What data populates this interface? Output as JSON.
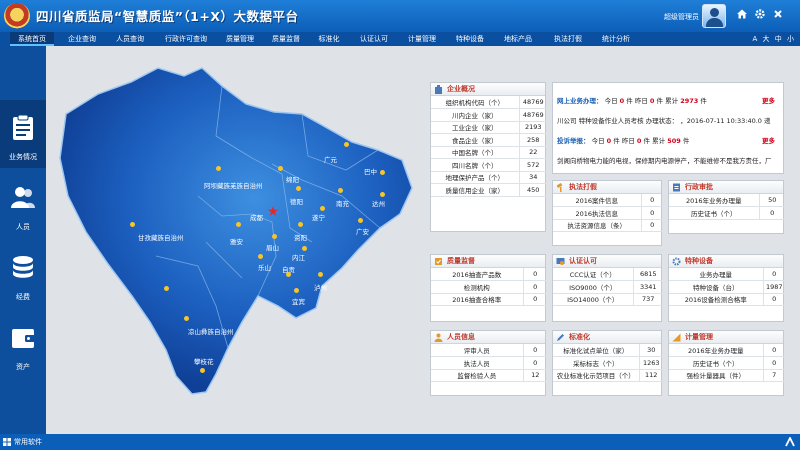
{
  "header": {
    "title": "四川省质监局“智慧质监”（1+X）大数据平台",
    "user_name": "超级管理员"
  },
  "nav": {
    "tabs": [
      "系统首页",
      "企业查询",
      "人员查询",
      "行政许可查询",
      "质量管理",
      "质量监督",
      "标准化",
      "认证认可",
      "计量管理",
      "特种设备",
      "地标产品",
      "执法打假",
      "统计分析"
    ],
    "font_size": {
      "label": "A",
      "large": "大",
      "medium": "中",
      "small": "小"
    }
  },
  "sidebar": {
    "items": [
      {
        "label": "业务情况"
      },
      {
        "label": "人员"
      },
      {
        "label": "经费"
      },
      {
        "label": "资产"
      }
    ]
  },
  "map": {
    "cities": [
      "广元",
      "巴中",
      "绵阳",
      "阿坝藏族羌族自治州",
      "德阳",
      "南充",
      "达州",
      "成都",
      "遂宁",
      "广安",
      "甘孜藏族自治州",
      "雅安",
      "眉山",
      "资阳",
      "乐山",
      "内江",
      "自贡",
      "宜宾",
      "泸州",
      "凉山彝族自治州",
      "攀枝花"
    ]
  },
  "panels": {
    "enterprise": {
      "title": "企业概况",
      "rows": [
        [
          "组织机构代码（个）",
          "48769"
        ],
        [
          "川内企业（家）",
          "48769"
        ],
        [
          "工业企业（家）",
          "2193"
        ],
        [
          "食品企业（家）",
          "258"
        ],
        [
          "中国名牌（个）",
          "22"
        ],
        [
          "四川名牌（个）",
          "572"
        ],
        [
          "地理保护产品（个）",
          "34"
        ],
        [
          "质量信用企业（家）",
          "450"
        ]
      ]
    },
    "enforcement": {
      "title": "执法打假",
      "rows": [
        [
          "2016案件信息",
          "0"
        ],
        [
          "2016执法信息",
          "0"
        ],
        [
          "执法资源信息（条）",
          "0"
        ]
      ]
    },
    "admin": {
      "title": "行政审批",
      "rows": [
        [
          "2016年业务办理量",
          "50"
        ],
        [
          "历史证书（个）",
          "0"
        ]
      ]
    },
    "quality": {
      "title": "质量监督",
      "rows": [
        [
          "2016抽查产品数",
          "0"
        ],
        [
          "检测机构",
          "0"
        ],
        [
          "2016抽查合格率",
          "0"
        ]
      ]
    },
    "certification": {
      "title": "认证认可",
      "rows": [
        [
          "CCC认证（个）",
          "6815"
        ],
        [
          "ISO9000（个）",
          "3341"
        ],
        [
          "ISO14000（个）",
          "737"
        ]
      ]
    },
    "special": {
      "title": "特种设备",
      "rows": [
        [
          "业务办理量",
          "0"
        ],
        [
          "特种设备（台）",
          "1987"
        ],
        [
          "2016设备检测合格率",
          "0"
        ]
      ]
    },
    "personnel": {
      "title": "人员信息",
      "rows": [
        [
          "评审人员",
          "0"
        ],
        [
          "执法人员",
          "0"
        ],
        [
          "监督检验人员",
          "12"
        ]
      ]
    },
    "standard": {
      "title": "标准化",
      "rows": [
        [
          "标准化试点单位（家）",
          "30"
        ],
        [
          "采标标志（个）",
          "1263"
        ],
        [
          "农业标准化示范项目（个）",
          "112"
        ]
      ]
    },
    "metrology": {
      "title": "计量管理",
      "rows": [
        [
          "2016年业务办理量",
          "0"
        ],
        [
          "历史证书（个）",
          "0"
        ],
        [
          "强检计量器具（件）",
          "7"
        ]
      ]
    }
  },
  "notice": {
    "online": {
      "label": "网上业务办理：",
      "today_label": "今日",
      "today": "0",
      "yesterday_label": "件 昨日",
      "yesterday": "0",
      "total_label": "件 累计",
      "total": "2973",
      "unit": "件",
      "more": "更多"
    },
    "online_msg": "川公司  特种设备作业人员考核  办理状态：  ，2016-07-11 10:33:40.0 递",
    "complaint": {
      "label": "投诉举报：",
      "today_label": "今日",
      "today": "0",
      "yesterday_label": "件 昨日",
      "yesterday": "0",
      "total_label": "件 累计",
      "total": "509",
      "unit": "件",
      "more": "更多"
    },
    "complaint_msg": "剑阁向桥物电力能的电视，保修期内电源停产，不能维修不是我方责任，厂"
  },
  "footer": {
    "label": "常用软件"
  },
  "colors": {
    "header_blue": "#1f7fd8",
    "nav_blue": "#0a4fa0",
    "accent_red": "#d0021b"
  }
}
